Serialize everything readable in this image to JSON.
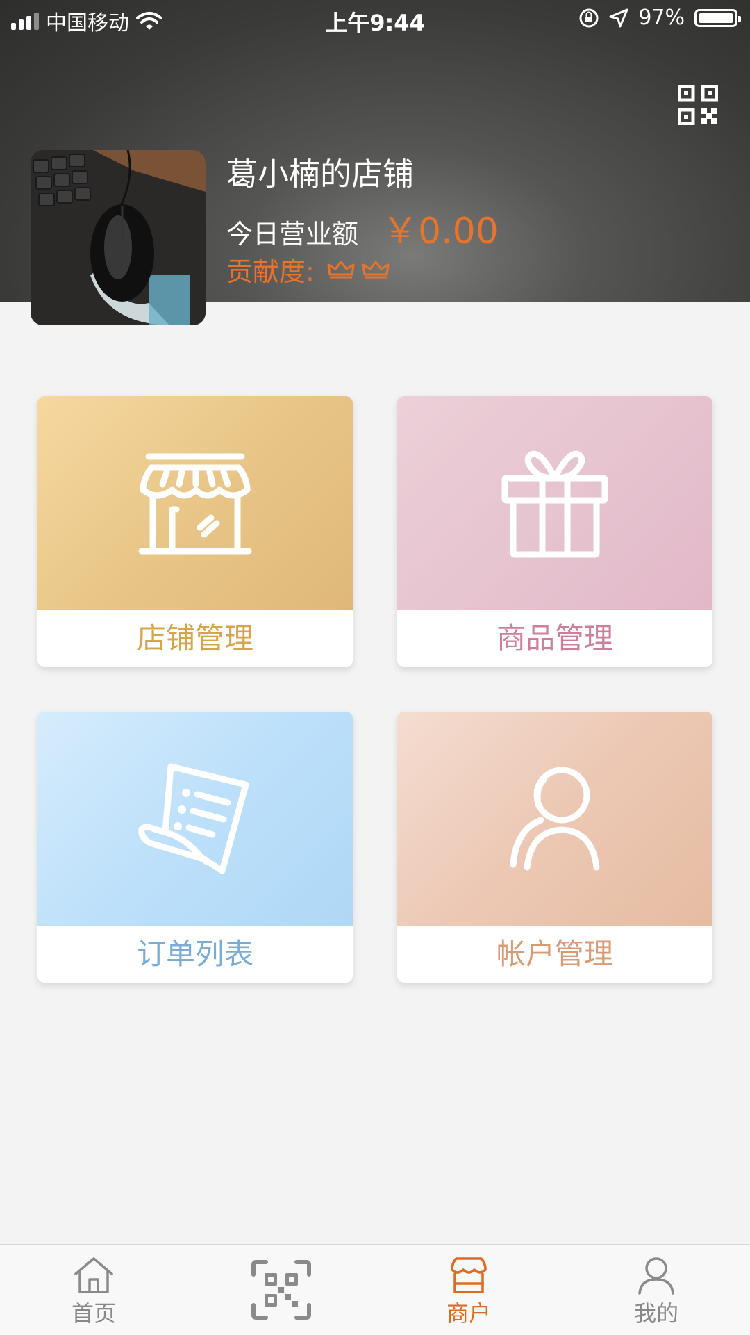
{
  "status_bar": {
    "carrier": "中国移动",
    "time": "上午9:44",
    "battery": "97%"
  },
  "shop": {
    "name": "葛小楠的店铺",
    "revenue_label": "今日营业额",
    "revenue_value": "￥0.00",
    "contribution_label": "贡献度:",
    "contribution_crowns": 2
  },
  "tiles": [
    {
      "label": "店铺管理",
      "icon": "storefront-icon"
    },
    {
      "label": "商品管理",
      "icon": "gift-icon"
    },
    {
      "label": "订单列表",
      "icon": "receipt-icon"
    },
    {
      "label": "帐户管理",
      "icon": "user-icon"
    }
  ],
  "tab_bar": {
    "items": [
      {
        "label": "首页",
        "icon": "home-icon",
        "active": false
      },
      {
        "label": "",
        "icon": "scan-icon",
        "active": false
      },
      {
        "label": "商户",
        "icon": "shop-icon",
        "active": true
      },
      {
        "label": "我的",
        "icon": "person-icon",
        "active": false
      }
    ]
  },
  "colors": {
    "accent_orange": "#e8742c",
    "shop_tile_text": "#d8a44a",
    "goods_tile_text": "#cc7e9a",
    "orders_tile_text": "#79acd8",
    "account_tile_text": "#d99a74",
    "active_tab": "#e06b1f",
    "inactive_tab": "#888888"
  }
}
